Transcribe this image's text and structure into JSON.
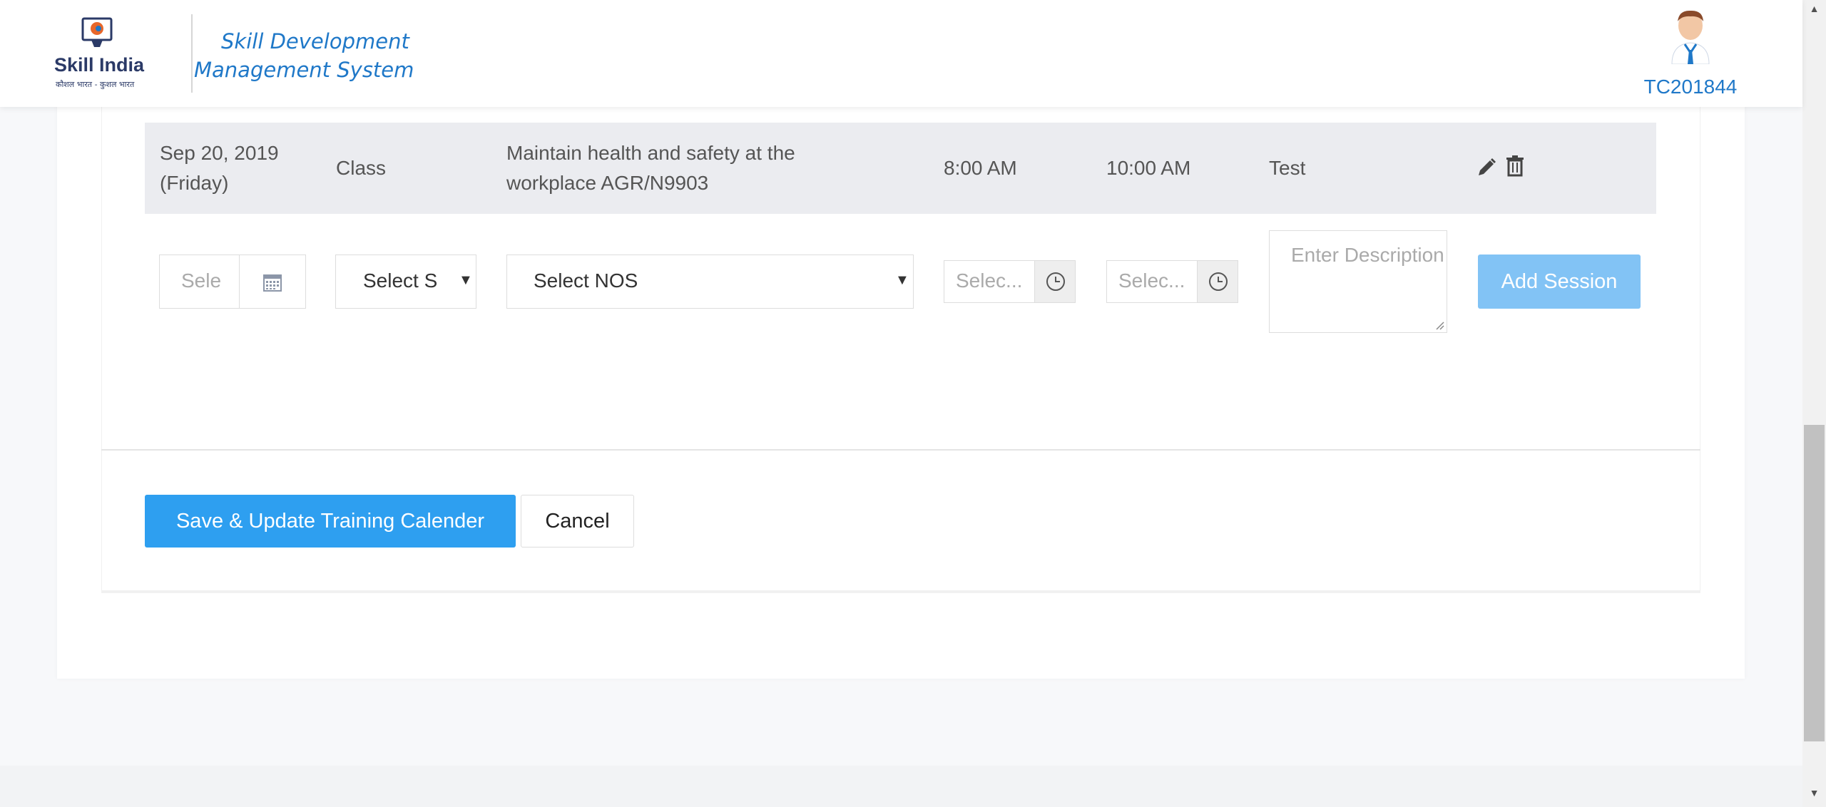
{
  "header": {
    "logo_text": "Skill India",
    "logo_subtext": "कौशल भारत - कुशल भारत",
    "app_title": "Skill Development Management System",
    "user_id": "TC201844"
  },
  "session_row": {
    "date": "Sep 20, 2019 (Friday)",
    "type": "Class",
    "nos": "Maintain health and safety at the workplace AGR/N9903",
    "start_time": "8:00 AM",
    "end_time": "10:00 AM",
    "description": "Test"
  },
  "form": {
    "date_placeholder": "Sele",
    "session_type_selected": "Select S",
    "nos_selected": "Select NOS",
    "start_time_placeholder": "Selec...",
    "end_time_placeholder": "Selec...",
    "description_placeholder": "Enter Description",
    "add_session_label": "Add Session"
  },
  "actions": {
    "save_label": "Save & Update Training Calender",
    "cancel_label": "Cancel"
  },
  "colors": {
    "accent": "#2e9ff0",
    "accent_light": "#82c3f5",
    "title_blue": "#1f78c8",
    "row_bg": "#ebecf0"
  }
}
